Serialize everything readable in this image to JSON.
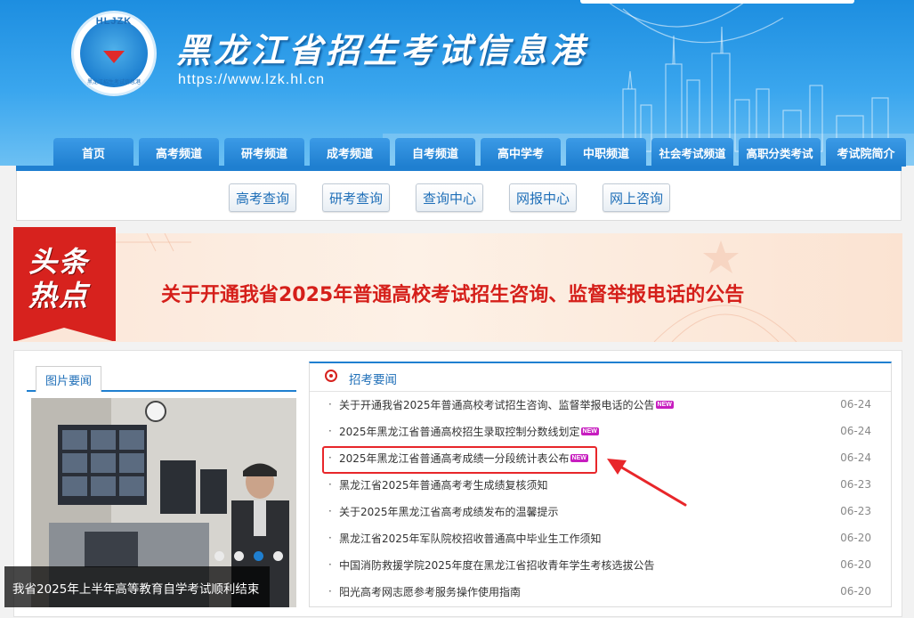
{
  "header": {
    "logo_abbr": "HLJZK",
    "logo_small_text": "黑龙江招生考试信息港",
    "site_title": "黑龙江省招生考试信息港",
    "site_url": "https://www.lzk.hl.cn"
  },
  "nav": {
    "items": [
      "首页",
      "高考频道",
      "研考频道",
      "成考频道",
      "自考频道",
      "高中学考",
      "中职频道",
      "社会考试频道",
      "高职分类考试",
      "考试院简介"
    ]
  },
  "subnav": {
    "buttons": [
      "高考查询",
      "研考查询",
      "查询中心",
      "网报中心",
      "网上咨询"
    ]
  },
  "banner": {
    "tag_line1": "头条",
    "tag_line2": "热点",
    "headline": "关于开通我省2025年普通高校考试招生咨询、监督举报电话的公告"
  },
  "photo_news": {
    "tab_label": "图片要闻",
    "caption": "我省2025年上半年高等教育自学考试顺利结束",
    "slide_count": 4,
    "active_slide": 3
  },
  "news": {
    "title": "招考要闻",
    "new_badge": "NEW",
    "items": [
      {
        "text": "关于开通我省2025年普通高校考试招生咨询、监督举报电话的公告",
        "date": "06-24",
        "is_new": true
      },
      {
        "text": "2025年黑龙江省普通高校招生录取控制分数线划定",
        "date": "06-24",
        "is_new": true
      },
      {
        "text": "2025年黑龙江省普通高考成绩一分段统计表公布",
        "date": "06-24",
        "is_new": true
      },
      {
        "text": "黑龙江省2025年普通高考考生成绩复核须知",
        "date": "06-23",
        "is_new": false
      },
      {
        "text": "关于2025年黑龙江省高考成绩发布的温馨提示",
        "date": "06-23",
        "is_new": false
      },
      {
        "text": "黑龙江省2025年军队院校招收普通高中毕业生工作须知",
        "date": "06-20",
        "is_new": false
      },
      {
        "text": "中国消防救援学院2025年度在黑龙江省招收青年学生考核选拔公告",
        "date": "06-20",
        "is_new": false
      },
      {
        "text": "阳光高考网志愿参考服务操作使用指南",
        "date": "06-20",
        "is_new": false
      }
    ]
  },
  "colors": {
    "brand_blue": "#1f7fd0",
    "headline_red": "#d51f1a",
    "new_badge": "#c71dbf",
    "highlight": "#e8262a"
  }
}
